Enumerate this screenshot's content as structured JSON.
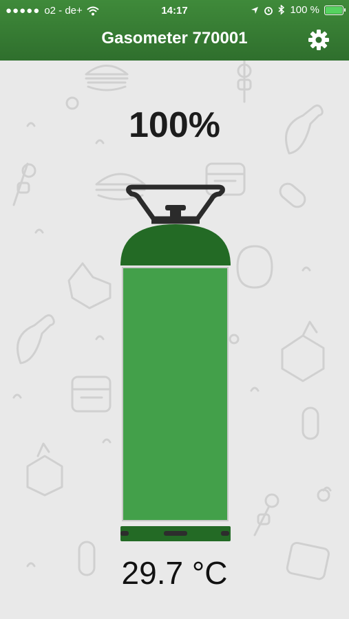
{
  "status_bar": {
    "carrier": "o2 - de+",
    "time": "14:17",
    "battery_text": "100 %"
  },
  "header": {
    "title": "Gasometer 770001",
    "settings_icon": "gear-icon"
  },
  "gauge": {
    "level_text": "100%",
    "level_fraction": 1.0,
    "temperature_text": "29.7 °C"
  },
  "colors": {
    "header": "#2f6f2d",
    "gas_fill": "#43a04a",
    "cylinder_cap": "#236a25",
    "background": "#e9e9e9"
  }
}
